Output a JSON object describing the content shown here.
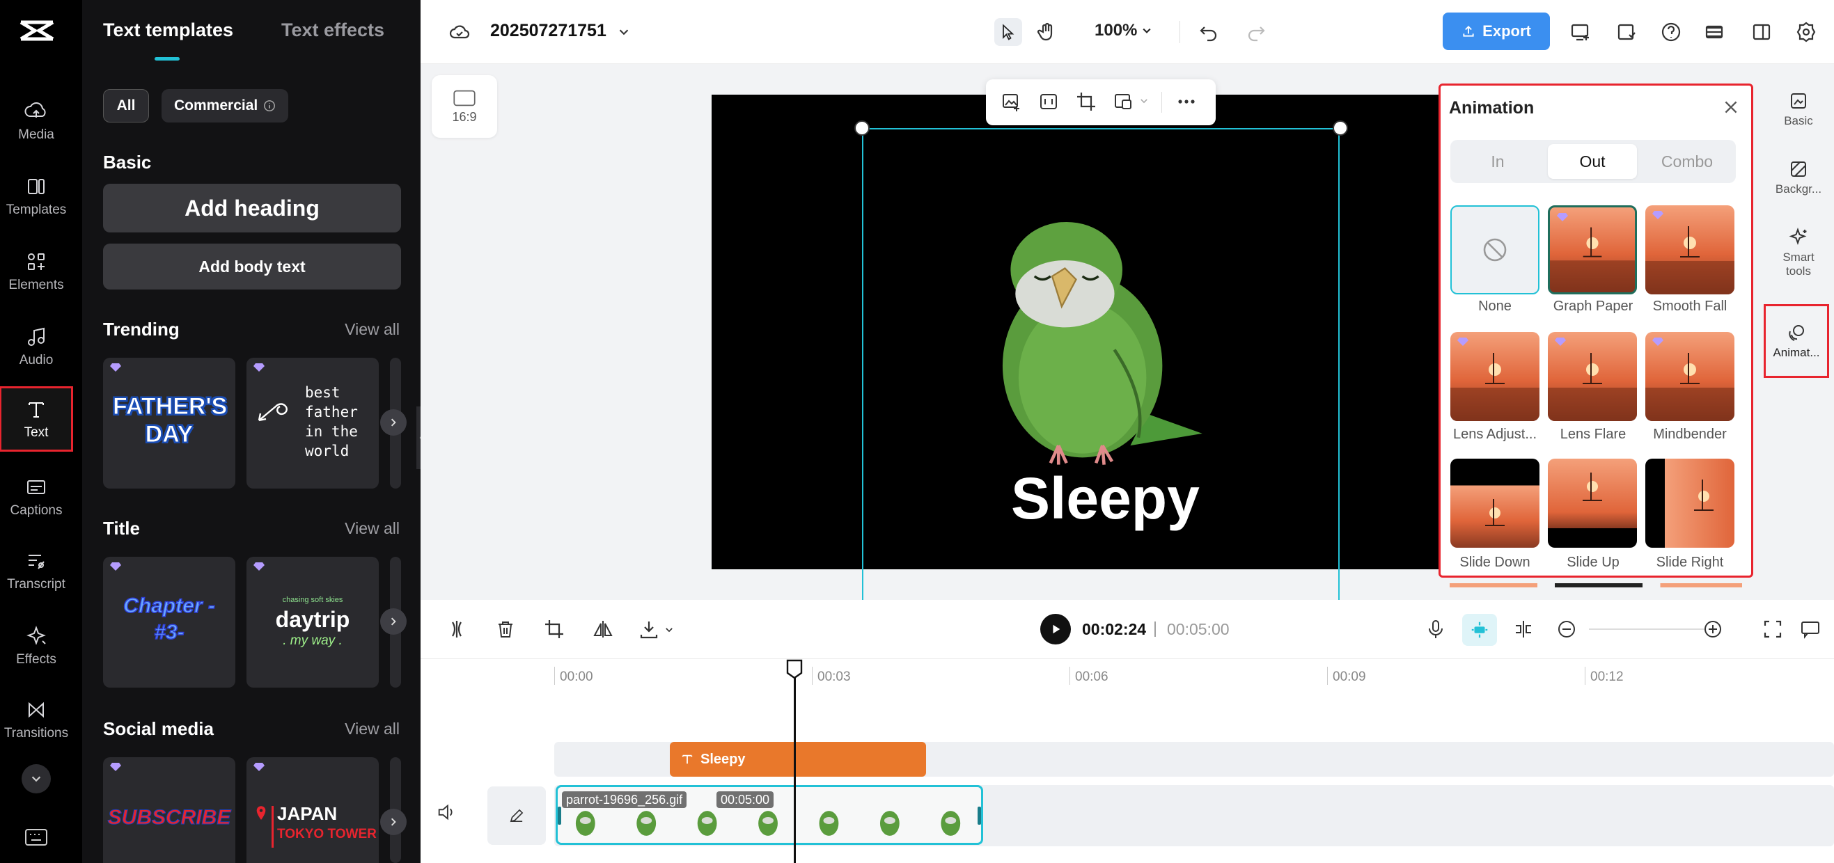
{
  "rail": {
    "items": [
      {
        "label": "Media",
        "icon": "media-icon"
      },
      {
        "label": "Templates",
        "icon": "templates-icon"
      },
      {
        "label": "Elements",
        "icon": "elements-icon"
      },
      {
        "label": "Audio",
        "icon": "audio-icon"
      },
      {
        "label": "Text",
        "icon": "text-icon"
      },
      {
        "label": "Captions",
        "icon": "captions-icon"
      },
      {
        "label": "Transcript",
        "icon": "transcript-icon"
      },
      {
        "label": "Effects",
        "icon": "effects-icon"
      },
      {
        "label": "Transitions",
        "icon": "transitions-icon"
      }
    ]
  },
  "panel": {
    "tabs": [
      "Text templates",
      "Text effects"
    ],
    "filters": [
      "All",
      "Commercial"
    ],
    "basic": {
      "title": "Basic",
      "add_heading": "Add heading",
      "add_body": "Add body text"
    },
    "trending": {
      "title": "Trending",
      "view_all": "View all",
      "cards": [
        "FATHER'S DAY",
        "best father in the world"
      ]
    },
    "title_section": {
      "title": "Title",
      "view_all": "View all",
      "cards": [
        "Chapter -#3-",
        "daytrip",
        "chasing soft skies",
        ". my way ."
      ]
    },
    "social": {
      "title": "Social media",
      "view_all": "View all",
      "cards": [
        "SUBSCRIBE",
        "JAPAN",
        "TOKYO TOWER"
      ]
    }
  },
  "topbar": {
    "project_name": "202507271751",
    "zoom": "100%",
    "export_label": "Export"
  },
  "canvas": {
    "aspect_label": "16:9",
    "caption_text": "Sleepy"
  },
  "animation": {
    "title": "Animation",
    "tabs": [
      "In",
      "Out",
      "Combo"
    ],
    "active_tab": "Out",
    "options": [
      "None",
      "Graph Paper",
      "Smooth Fall",
      "Lens Adjust...",
      "Lens Flare",
      "Mindbender",
      "Slide Down",
      "Slide Up",
      "Slide Right"
    ]
  },
  "right_rail": {
    "items": [
      "Basic",
      "Backgr...",
      "Smart tools",
      "Animat..."
    ]
  },
  "playback": {
    "current_time": "00:02:24",
    "separator": "|",
    "total_time": "00:05:00"
  },
  "timeline": {
    "ruler": [
      "00:00",
      "00:03",
      "00:06",
      "00:09",
      "00:12"
    ],
    "text_clip": "Sleepy",
    "video_clip_name": "parrot-19696_256.gif",
    "video_clip_duration": "00:05:00"
  },
  "colors": {
    "accent_teal": "#22c1d6",
    "export_blue": "#3b8ff0",
    "text_clip_orange": "#e9782b",
    "highlight_red": "#e8242e"
  }
}
